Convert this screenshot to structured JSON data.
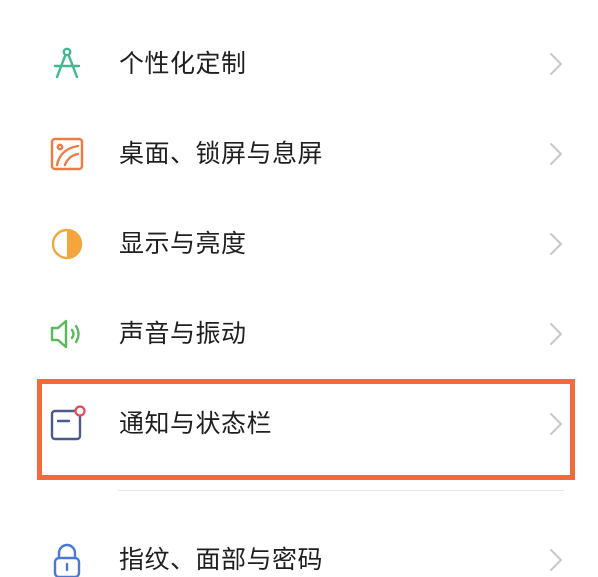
{
  "settings": {
    "items": [
      {
        "label": "个性化定制",
        "icon": "compass-icon",
        "icon_color": "#3fb98f"
      },
      {
        "label": "桌面、锁屏与息屏",
        "icon": "wallpaper-icon",
        "icon_color": "#ef7a43"
      },
      {
        "label": "显示与亮度",
        "icon": "brightness-icon",
        "icon_color": "#f3a63b"
      },
      {
        "label": "声音与振动",
        "icon": "speaker-icon",
        "icon_color": "#5cb85c"
      },
      {
        "label": "通知与状态栏",
        "icon": "notification-icon",
        "icon_color": "#4b5a8a",
        "badge_color": "#e8475a"
      },
      {
        "label": "指纹、面部与密码",
        "icon": "lock-icon",
        "icon_color": "#4a78d6"
      }
    ],
    "chevron_color": "#c8c8c8",
    "highlight_color": "#f56a3c"
  }
}
